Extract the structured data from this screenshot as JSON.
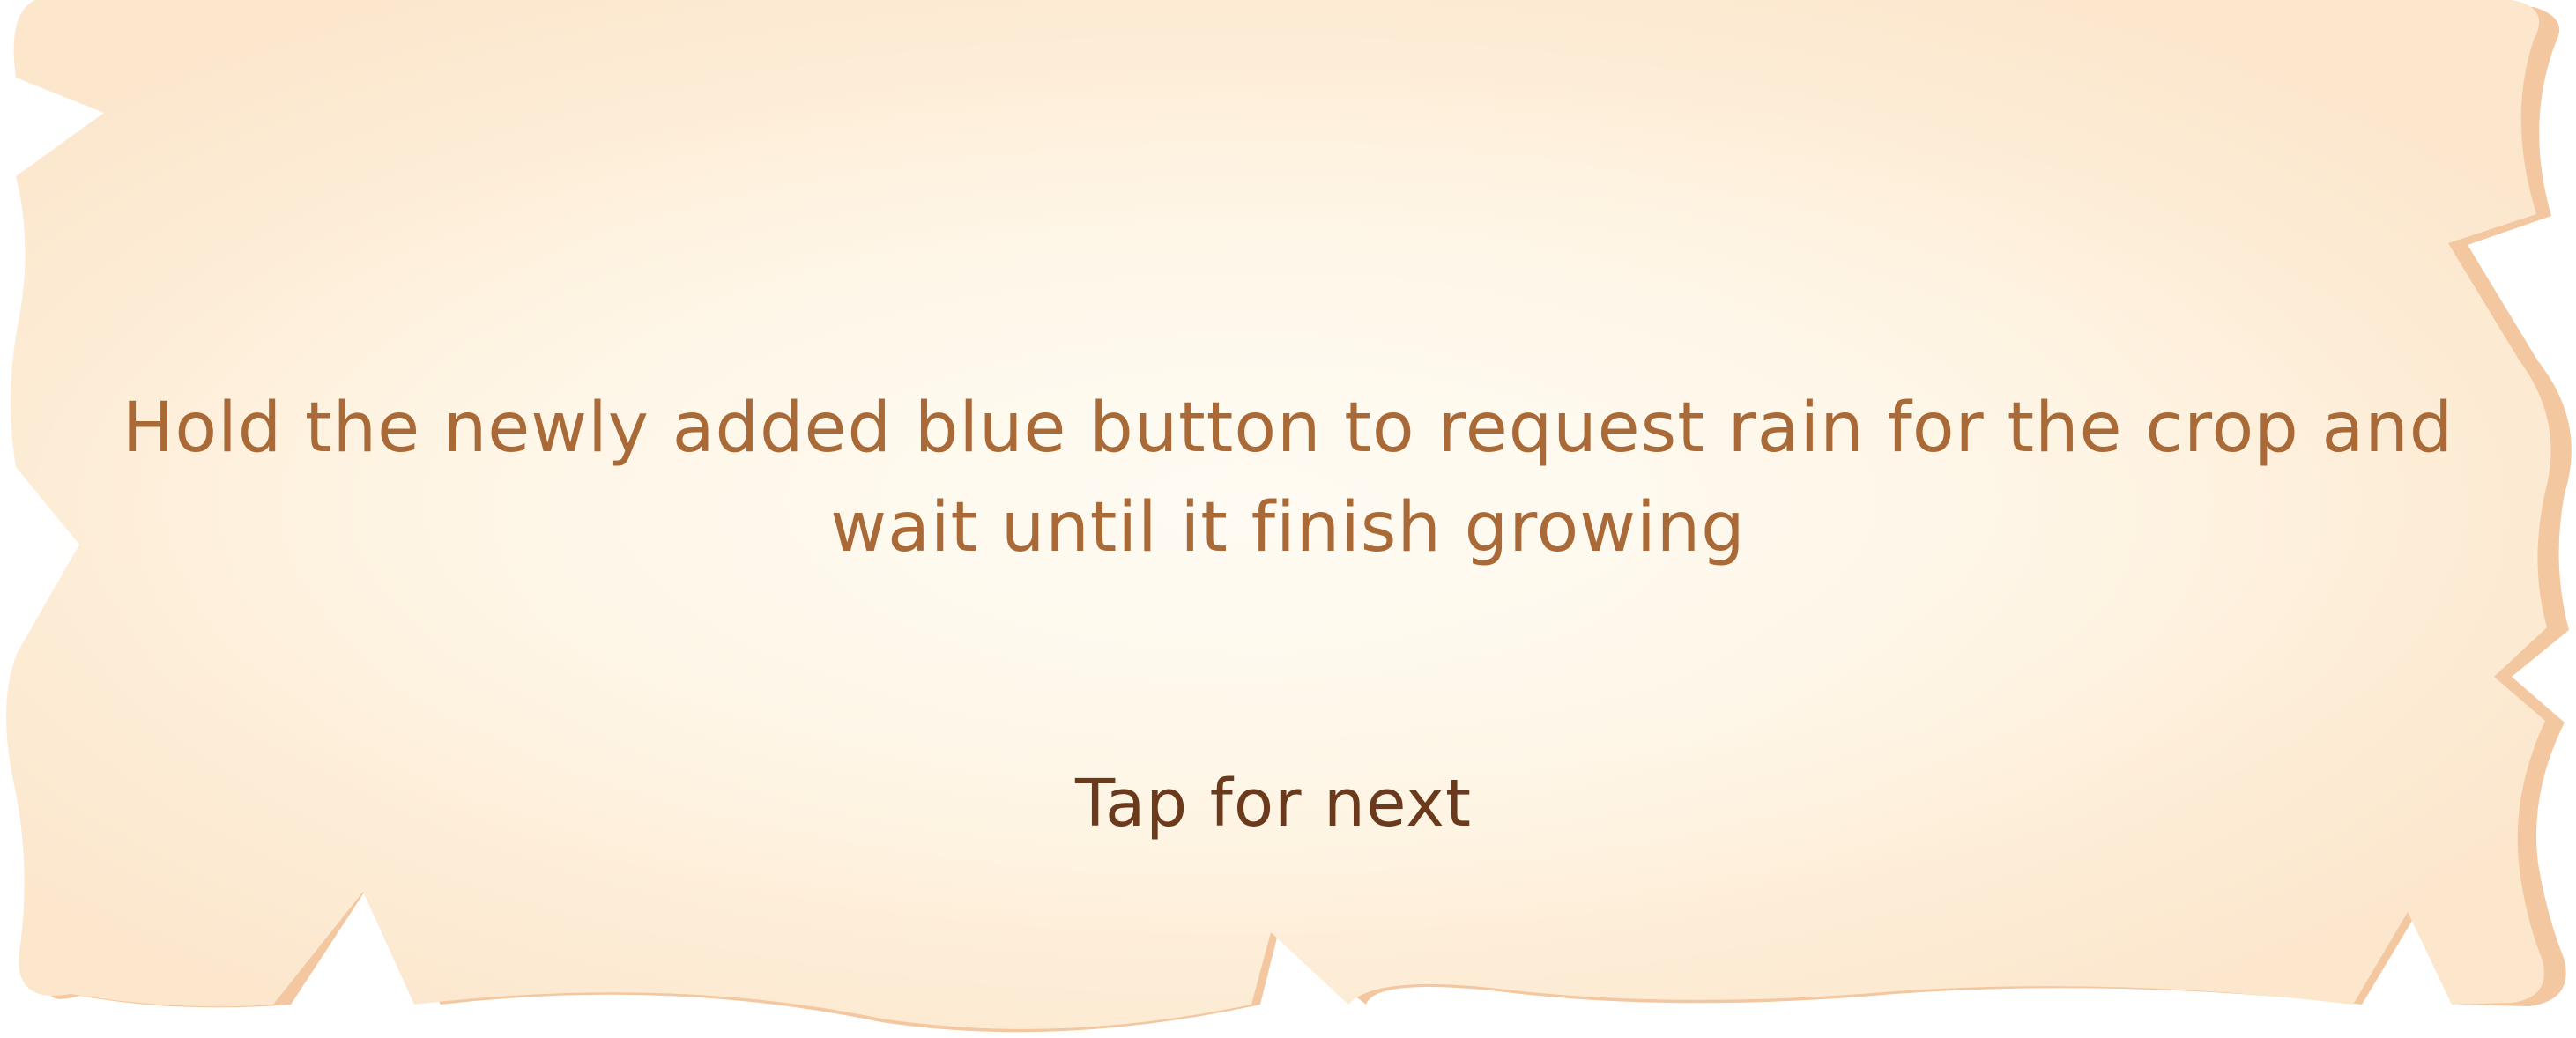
{
  "tutorial": {
    "message": "Hold the newly added blue button to request rain for the crop and wait until it finish growing",
    "next_label": "Tap for next"
  },
  "colors": {
    "parchment_light": "#fff8ea",
    "parchment_mid": "#fdebd2",
    "parchment_edge": "#f3c7a0",
    "message_text": "#a96a38",
    "next_text": "#6b3a1c"
  }
}
